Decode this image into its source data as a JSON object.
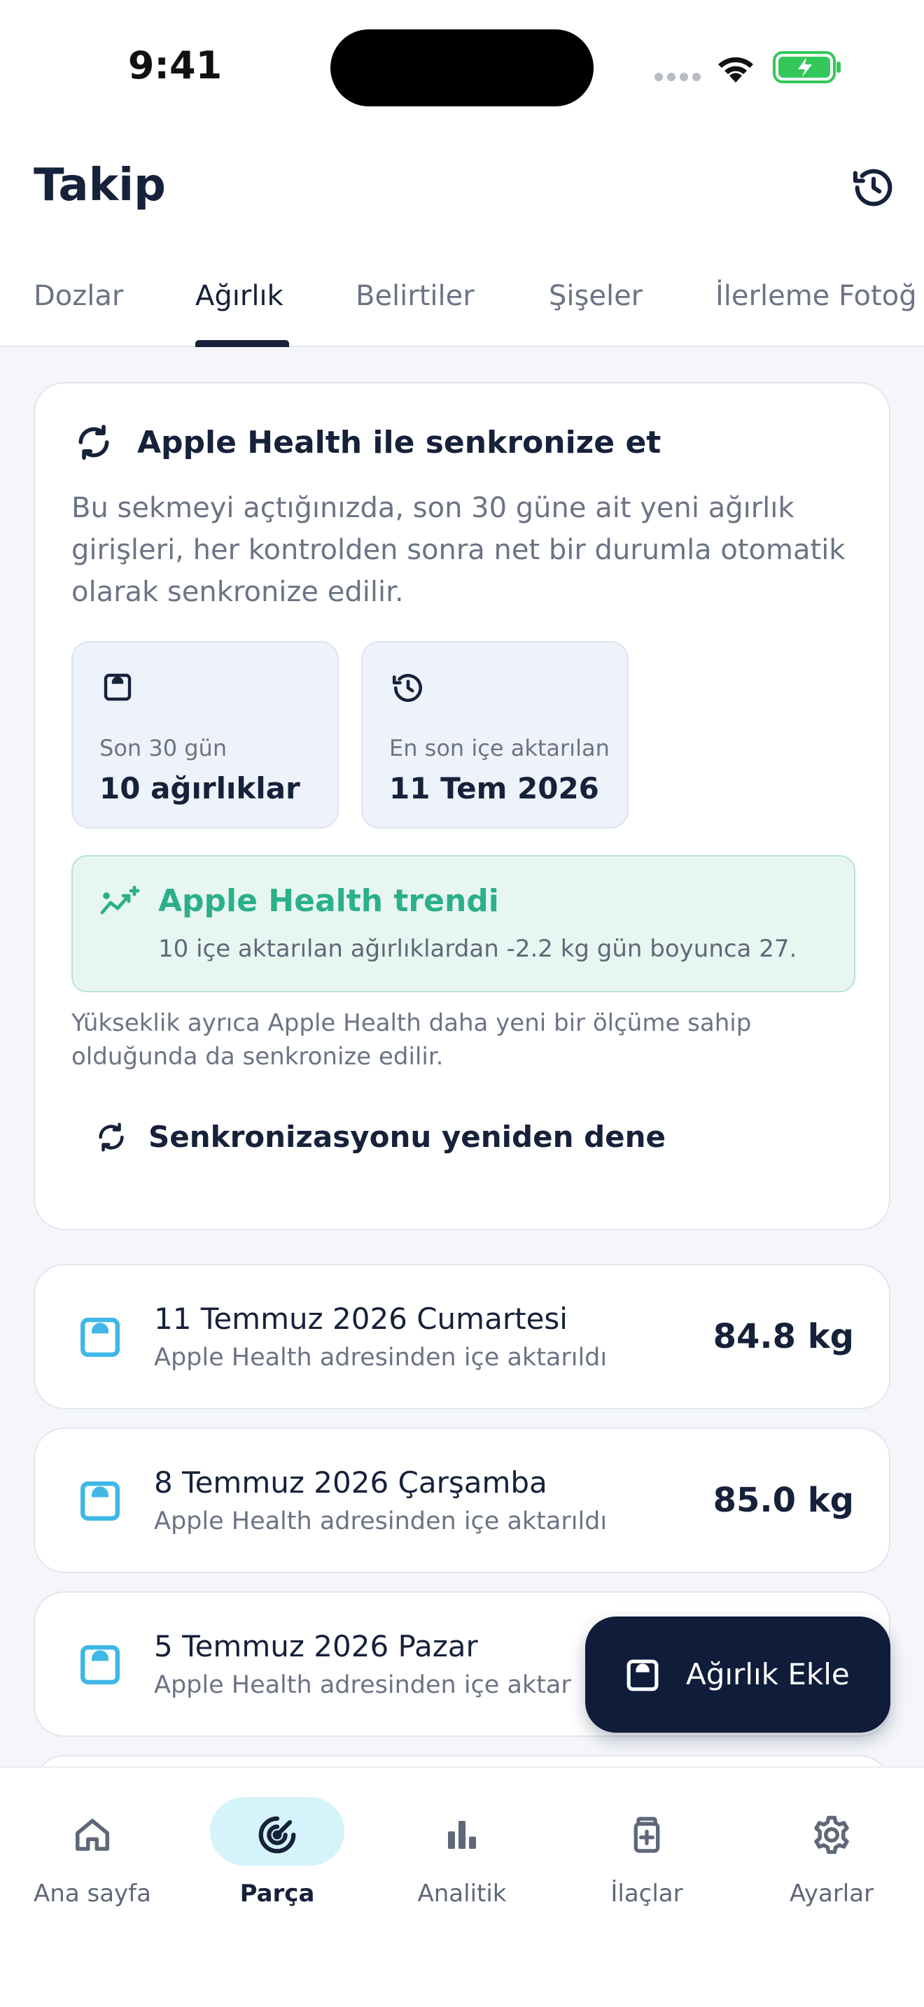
{
  "status_bar": {
    "time": "9:41"
  },
  "header": {
    "title": "Takip"
  },
  "tabs": [
    {
      "label": "Dozlar",
      "active": false
    },
    {
      "label": "Ağırlık",
      "active": true
    },
    {
      "label": "Belirtiler",
      "active": false
    },
    {
      "label": "Şişeler",
      "active": false
    },
    {
      "label": "İlerleme Fotoğ",
      "active": false
    }
  ],
  "sync": {
    "title": "Apple Health ile senkronize et",
    "description": "Bu sekmeyi açtığınızda, son 30 güne ait yeni ağırlık girişleri, her kontrolden sonra net bir durumla otomatik olarak senkronize edilir.",
    "stats": [
      {
        "label": "Son 30 gün",
        "value": "10 ağırlıklar",
        "icon": "scale-icon"
      },
      {
        "label": "En son içe aktarılan",
        "value": "11 Tem 2026",
        "icon": "history-icon"
      }
    ],
    "trend": {
      "title": "Apple Health trendi",
      "text": "10 içe aktarılan ağırlıklardan -2.2 kg gün boyunca 27."
    },
    "height_note": "Yükseklik ayrıca Apple Health daha yeni bir ölçüme sahip olduğunda da senkronize edilir.",
    "retry_label": "Senkronizasyonu yeniden dene"
  },
  "entries": [
    {
      "date": "11 Temmuz 2026 Cumartesi",
      "source": "Apple Health adresinden içe aktarıldı",
      "weight": "84.8 kg"
    },
    {
      "date": "8 Temmuz 2026 Çarşamba",
      "source": "Apple Health adresinden içe aktarıldı",
      "weight": "85.0 kg"
    },
    {
      "date": "5 Temmuz 2026 Pazar",
      "source": "Apple Health adresinden içe aktar",
      "weight": ""
    }
  ],
  "fab": {
    "label": "Ağırlık Ekle"
  },
  "nav": [
    {
      "label": "Ana sayfa",
      "icon": "home-icon",
      "active": false
    },
    {
      "label": "Parça",
      "icon": "track-icon",
      "active": true
    },
    {
      "label": "Analitik",
      "icon": "analytics-icon",
      "active": false
    },
    {
      "label": "İlaçlar",
      "icon": "medication-icon",
      "active": false
    },
    {
      "label": "Ayarlar",
      "icon": "settings-icon",
      "active": false
    }
  ],
  "colors": {
    "primary": "#16213a",
    "muted": "#6b7485",
    "accent_green": "#2bb089",
    "accent_cyan": "#3fb8e6",
    "fab_bg": "#0f1c3a",
    "nav_active_pill": "#d4f3fb"
  }
}
